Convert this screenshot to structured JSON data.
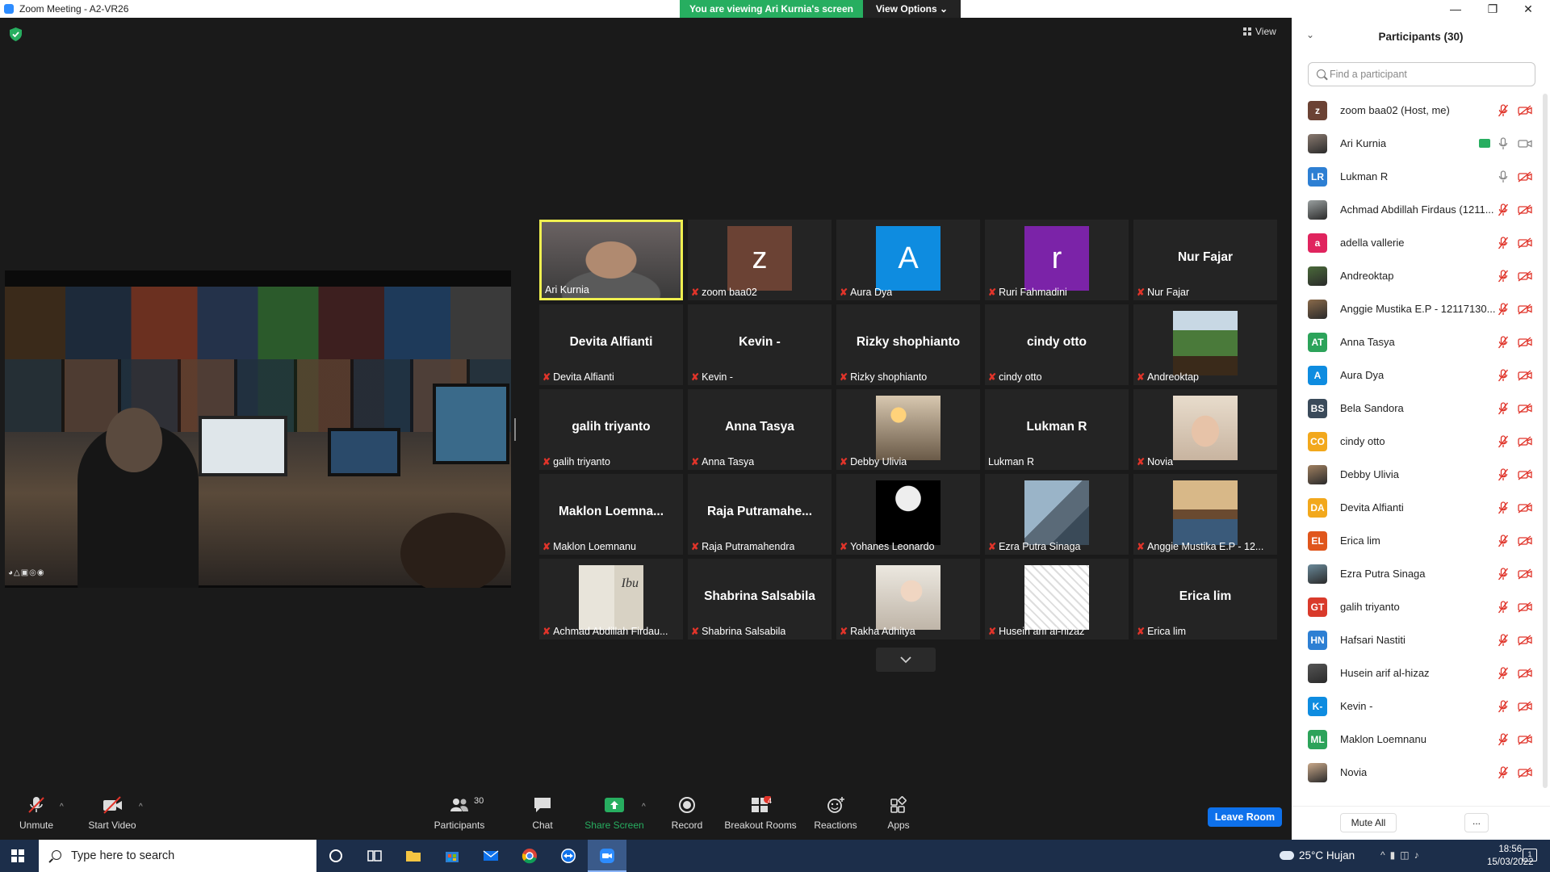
{
  "window": {
    "title": "Zoom Meeting - A2-VR26",
    "viewing_banner": "You are viewing Ari Kurnia's screen",
    "view_options": "View Options",
    "view_button": "View"
  },
  "shared_screen": {
    "hud_icons": "◕△▣◎◉"
  },
  "video_tiles": [
    {
      "display": "video",
      "label": "Ari Kurnia",
      "muted": false,
      "active": true
    },
    {
      "display": "avatar",
      "avatar_letter": "z",
      "avatar_color": "#6b4234",
      "label": "zoom baa02",
      "muted": true
    },
    {
      "display": "avatar",
      "avatar_letter": "A",
      "avatar_color": "#0e8ce0",
      "label": "Aura Dya",
      "muted": true
    },
    {
      "display": "avatar",
      "avatar_letter": "r",
      "avatar_color": "#7b23a8",
      "label": "Ruri Fahmadini",
      "muted": true
    },
    {
      "display": "name",
      "big_name": "Nur Fajar",
      "label": "Nur Fajar",
      "muted": true
    },
    {
      "display": "name",
      "big_name": "Devita Alfianti",
      "label": "Devita Alfianti",
      "muted": true
    },
    {
      "display": "name",
      "big_name": "Kevin -",
      "label": "Kevin -",
      "muted": true
    },
    {
      "display": "name",
      "big_name": "Rizky shophianto",
      "label": "Rizky shophianto",
      "muted": true
    },
    {
      "display": "name",
      "big_name": "cindy otto",
      "label": "cindy otto",
      "muted": true
    },
    {
      "display": "photo",
      "photo": "forest",
      "label": "Andreoktap",
      "muted": true
    },
    {
      "display": "name",
      "big_name": "galih triyanto",
      "label": "galih triyanto",
      "muted": true
    },
    {
      "display": "name",
      "big_name": "Anna Tasya",
      "label": "Anna Tasya",
      "muted": true
    },
    {
      "display": "photo",
      "photo": "lamp-room",
      "label": "Debby Ulivia",
      "muted": true
    },
    {
      "display": "name",
      "big_name": "Lukman R",
      "label": "Lukman R",
      "muted": false
    },
    {
      "display": "photo",
      "photo": "hijab-selfie",
      "label": "Novia",
      "muted": true
    },
    {
      "display": "name",
      "big_name": "Maklon  Loemna...",
      "label": "Maklon Loemnanu",
      "muted": true
    },
    {
      "display": "name",
      "big_name": "Raja  Putramahe...",
      "label": "Raja Putramahendra",
      "muted": true
    },
    {
      "display": "photo",
      "photo": "moon-astronaut",
      "label": "Yohanes Leonardo",
      "muted": true
    },
    {
      "display": "photo",
      "photo": "building",
      "label": "Ezra Putra Sinaga",
      "muted": true
    },
    {
      "display": "photo",
      "photo": "group-photo",
      "label": "Anggie Mustika E.P - 12...",
      "muted": true
    },
    {
      "display": "photo",
      "photo": "book-cover",
      "photo_text": "Ibu",
      "label": "Achmad Abdillah Firdau...",
      "muted": true
    },
    {
      "display": "name",
      "big_name": "Shabrina Salsabila",
      "label": "Shabrina Salsabila",
      "muted": true
    },
    {
      "display": "photo",
      "photo": "baby",
      "label": "Rakha Adhitya",
      "muted": true
    },
    {
      "display": "photo",
      "photo": "manga",
      "label": "Husein arif al-hizaz",
      "muted": true
    },
    {
      "display": "name",
      "big_name": "Erica lim",
      "label": "Erica lim",
      "muted": true
    }
  ],
  "toolbar": {
    "unmute": "Unmute",
    "start_video": "Start Video",
    "participants": "Participants",
    "participants_count": "30",
    "chat": "Chat",
    "share_screen": "Share Screen",
    "record": "Record",
    "breakout_rooms": "Breakout Rooms",
    "breakout_badge": "4",
    "reactions": "Reactions",
    "apps": "Apps",
    "leave_room": "Leave Room",
    "share_color": "#27ae60",
    "leave_color": "#0e71eb"
  },
  "panel": {
    "title": "Participants (30)",
    "search_placeholder": "Find a participant",
    "mute_all": "Mute All",
    "more": "..."
  },
  "participants": [
    {
      "name": "zoom baa02 (Host, me)",
      "avatar_type": "initials",
      "initials": "z",
      "color": "#6b4234",
      "mic": "muted",
      "video": "off"
    },
    {
      "name": "Ari Kurnia",
      "avatar_type": "photo",
      "color": "#8a7a70",
      "mic": "on",
      "video": "on",
      "sharing": true
    },
    {
      "name": "Lukman R",
      "avatar_type": "initials",
      "initials": "LR",
      "color": "#2d7fd3",
      "mic": "on",
      "video": "off"
    },
    {
      "name": "Achmad Abdillah Firdaus (1211...",
      "avatar_type": "photo",
      "color": "#9aa0a0",
      "mic": "muted",
      "video": "off"
    },
    {
      "name": "adella vallerie",
      "avatar_type": "initials",
      "initials": "a",
      "color": "#e0245e",
      "mic": "muted",
      "video": "off"
    },
    {
      "name": "Andreoktap",
      "avatar_type": "photo",
      "color": "#4a6a3a",
      "mic": "muted",
      "video": "off"
    },
    {
      "name": "Anggie Mustika E.P - 12117130...",
      "avatar_type": "photo",
      "color": "#8a6a4a",
      "mic": "muted",
      "video": "off"
    },
    {
      "name": "Anna Tasya",
      "avatar_type": "initials",
      "initials": "AT",
      "color": "#2ca35a",
      "mic": "muted",
      "video": "off"
    },
    {
      "name": "Aura Dya",
      "avatar_type": "initials",
      "initials": "A",
      "color": "#0e8ce0",
      "mic": "muted",
      "video": "off"
    },
    {
      "name": "Bela Sandora",
      "avatar_type": "initials",
      "initials": "BS",
      "color": "#3a4a5a",
      "mic": "muted",
      "video": "off"
    },
    {
      "name": "cindy otto",
      "avatar_type": "initials",
      "initials": "CO",
      "color": "#f2a81c",
      "mic": "muted",
      "video": "off"
    },
    {
      "name": "Debby Ulivia",
      "avatar_type": "photo",
      "color": "#a08060",
      "mic": "muted",
      "video": "off"
    },
    {
      "name": "Devita Alfianti",
      "avatar_type": "initials",
      "initials": "DA",
      "color": "#f2a81c",
      "mic": "muted",
      "video": "off"
    },
    {
      "name": "Erica lim",
      "avatar_type": "initials",
      "initials": "EL",
      "color": "#e0561c",
      "mic": "muted",
      "video": "off"
    },
    {
      "name": "Ezra Putra Sinaga",
      "avatar_type": "photo",
      "color": "#6a8a9a",
      "mic": "muted",
      "video": "off"
    },
    {
      "name": "galih triyanto",
      "avatar_type": "initials",
      "initials": "GT",
      "color": "#d93a2b",
      "mic": "muted",
      "video": "off"
    },
    {
      "name": "Hafsari Nastiti",
      "avatar_type": "initials",
      "initials": "HN",
      "color": "#2d7fd3",
      "mic": "muted",
      "video": "off"
    },
    {
      "name": "Husein arif al-hizaz",
      "avatar_type": "photo",
      "color": "#555555",
      "mic": "muted",
      "video": "off"
    },
    {
      "name": "Kevin -",
      "avatar_type": "initials",
      "initials": "K-",
      "color": "#0e8ce0",
      "mic": "muted",
      "video": "off"
    },
    {
      "name": "Maklon Loemnanu",
      "avatar_type": "initials",
      "initials": "ML",
      "color": "#2ca35a",
      "mic": "muted",
      "video": "off"
    },
    {
      "name": "Novia",
      "avatar_type": "photo",
      "color": "#c8a88a",
      "mic": "muted",
      "video": "off"
    }
  ],
  "taskbar": {
    "search_placeholder": "Type here to search",
    "weather": "25°C  Hujan",
    "time": "18:56",
    "date": "15/03/2022",
    "notifications": "1"
  }
}
